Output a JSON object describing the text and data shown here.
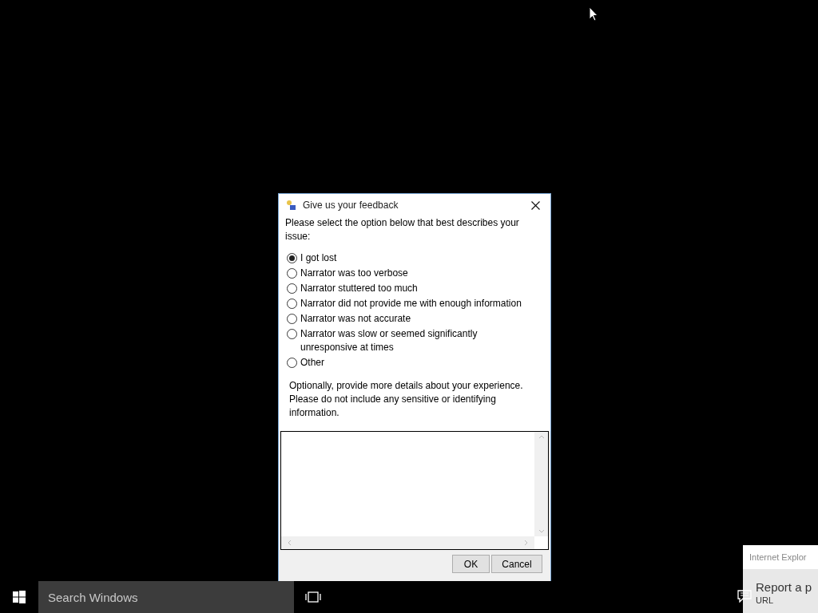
{
  "dialog": {
    "title": "Give us your feedback",
    "prompt": "Please select the option below that best describes your issue:",
    "options": [
      {
        "label": "I got lost",
        "selected": true
      },
      {
        "label": "Narrator was too verbose",
        "selected": false
      },
      {
        "label": "Narrator stuttered too much",
        "selected": false
      },
      {
        "label": "Narrator did not provide me with enough information",
        "selected": false
      },
      {
        "label": "Narrator was not accurate",
        "selected": false
      },
      {
        "label": "Narrator was slow or seemed significantly unresponsive at times",
        "selected": false
      },
      {
        "label": "Other",
        "selected": false
      }
    ],
    "details_note": "Optionally, provide more details about your experience. Please do not include any sensitive or identifying information.",
    "buttons": [
      "OK",
      "Cancel"
    ]
  },
  "notification": {
    "app": "Internet Explor",
    "title": "Report a p",
    "detail": "URL"
  },
  "taskbar": {
    "search_placeholder": "Search Windows"
  }
}
